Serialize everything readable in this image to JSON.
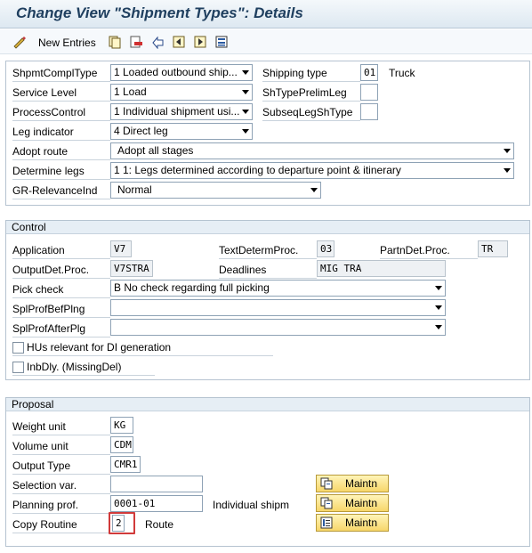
{
  "title": "Change View \"Shipment Types\": Details",
  "toolbar": {
    "new_entries": "New Entries"
  },
  "header": {
    "shpmt_compl_type": {
      "label": "ShpmtComplType",
      "value": "1 Loaded outbound ship..."
    },
    "shipping_type": {
      "label": "Shipping type",
      "value": "01",
      "text": "Truck"
    },
    "service_level": {
      "label": "Service Level",
      "value": "1 Load"
    },
    "sh_type_prelim_leg": {
      "label": "ShTypePrelimLeg",
      "value": ""
    },
    "process_control": {
      "label": "ProcessControl",
      "value": "1 Individual shipment usi..."
    },
    "subseq_leg_sh_type": {
      "label": "SubseqLegShType",
      "value": ""
    },
    "leg_indicator": {
      "label": "Leg indicator",
      "value": "4 Direct leg"
    },
    "adopt_route": {
      "label": "Adopt route",
      "value": "Adopt all stages"
    },
    "determine_legs": {
      "label": "Determine legs",
      "value": "1 1: Legs determined according to departure point & itinerary"
    },
    "gr_relevance": {
      "label": "GR-RelevanceInd",
      "value": "Normal"
    }
  },
  "control": {
    "title": "Control",
    "application": {
      "label": "Application",
      "value": "V7"
    },
    "text_determ_proc": {
      "label": "TextDetermProc.",
      "value": "03"
    },
    "partn_det_proc": {
      "label": "PartnDet.Proc.",
      "value": "TR"
    },
    "output_det_proc": {
      "label": "OutputDet.Proc.",
      "value": "V7STRA"
    },
    "deadlines": {
      "label": "Deadlines",
      "value": "MIG TRA"
    },
    "pick_check": {
      "label": "Pick check",
      "value": "B No check regarding full picking"
    },
    "spl_prof_bef_plng": {
      "label": "SplProfBefPlng",
      "value": ""
    },
    "spl_prof_after_plg": {
      "label": "SplProfAfterPlg",
      "value": ""
    },
    "hus_relevant": {
      "label": "HUs relevant for DI generation"
    },
    "inb_dly": {
      "label": "InbDly. (MissingDel)"
    }
  },
  "proposal": {
    "title": "Proposal",
    "weight_unit": {
      "label": "Weight unit",
      "value": "KG"
    },
    "volume_unit": {
      "label": "Volume unit",
      "value": "CDM"
    },
    "output_type": {
      "label": "Output Type",
      "value": "CMR1"
    },
    "selection_var": {
      "label": "Selection var.",
      "value": "",
      "button": "Maintn"
    },
    "planning_prof": {
      "label": "Planning prof.",
      "value": "0001-01",
      "text": "Individual shipm",
      "button": "Maintn"
    },
    "copy_routine": {
      "label": "Copy Routine",
      "value": "2",
      "text": "Route",
      "button": "Maintn"
    }
  },
  "colors": {
    "accent_title": "#1f3f5f",
    "highlight": "#d13a3a",
    "button": "#f7d66a"
  }
}
